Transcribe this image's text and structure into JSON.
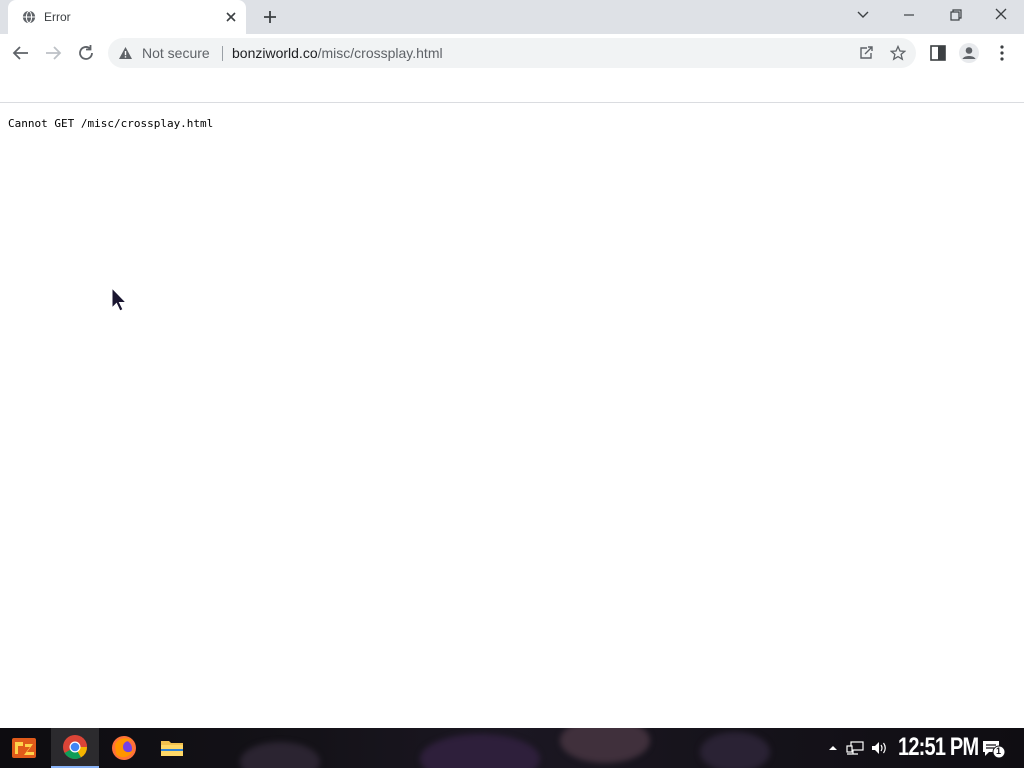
{
  "browser": {
    "tab": {
      "title": "Error",
      "favicon": "globe-icon"
    },
    "new_tab_icon": "plus-icon",
    "window_controls": [
      "chevron-down-icon",
      "minimize-icon",
      "restore-icon",
      "close-icon"
    ],
    "toolbar": {
      "back_icon": "arrow-left-icon",
      "forward_icon": "arrow-right-icon",
      "reload_icon": "reload-icon",
      "security_label": "Not secure",
      "url_host": "bonziworld.co",
      "url_path": "/misc/crossplay.html",
      "right_icons": [
        "share-icon",
        "star-icon",
        "side-panel-icon",
        "profile-icon",
        "kebab-menu-icon"
      ]
    }
  },
  "page": {
    "message": "Cannot GET /misc/crossplay.html"
  },
  "taskbar": {
    "pinned": [
      {
        "name": "start-button",
        "icon": "start-icon",
        "active": false
      },
      {
        "name": "chrome",
        "icon": "chrome-icon",
        "active": true
      },
      {
        "name": "firefox",
        "icon": "firefox-icon",
        "active": false
      },
      {
        "name": "file-explorer",
        "icon": "folder-icon",
        "active": false
      }
    ],
    "tray_icons": [
      "chevron-up-icon",
      "network-icon",
      "volume-icon"
    ],
    "clock": "12:51 PM",
    "notification_count": "1"
  },
  "colors": {
    "tabstrip": "#dee1e6",
    "omnibox": "#f1f3f4",
    "taskbar": "#141218",
    "accent": "#8ab4f8"
  }
}
